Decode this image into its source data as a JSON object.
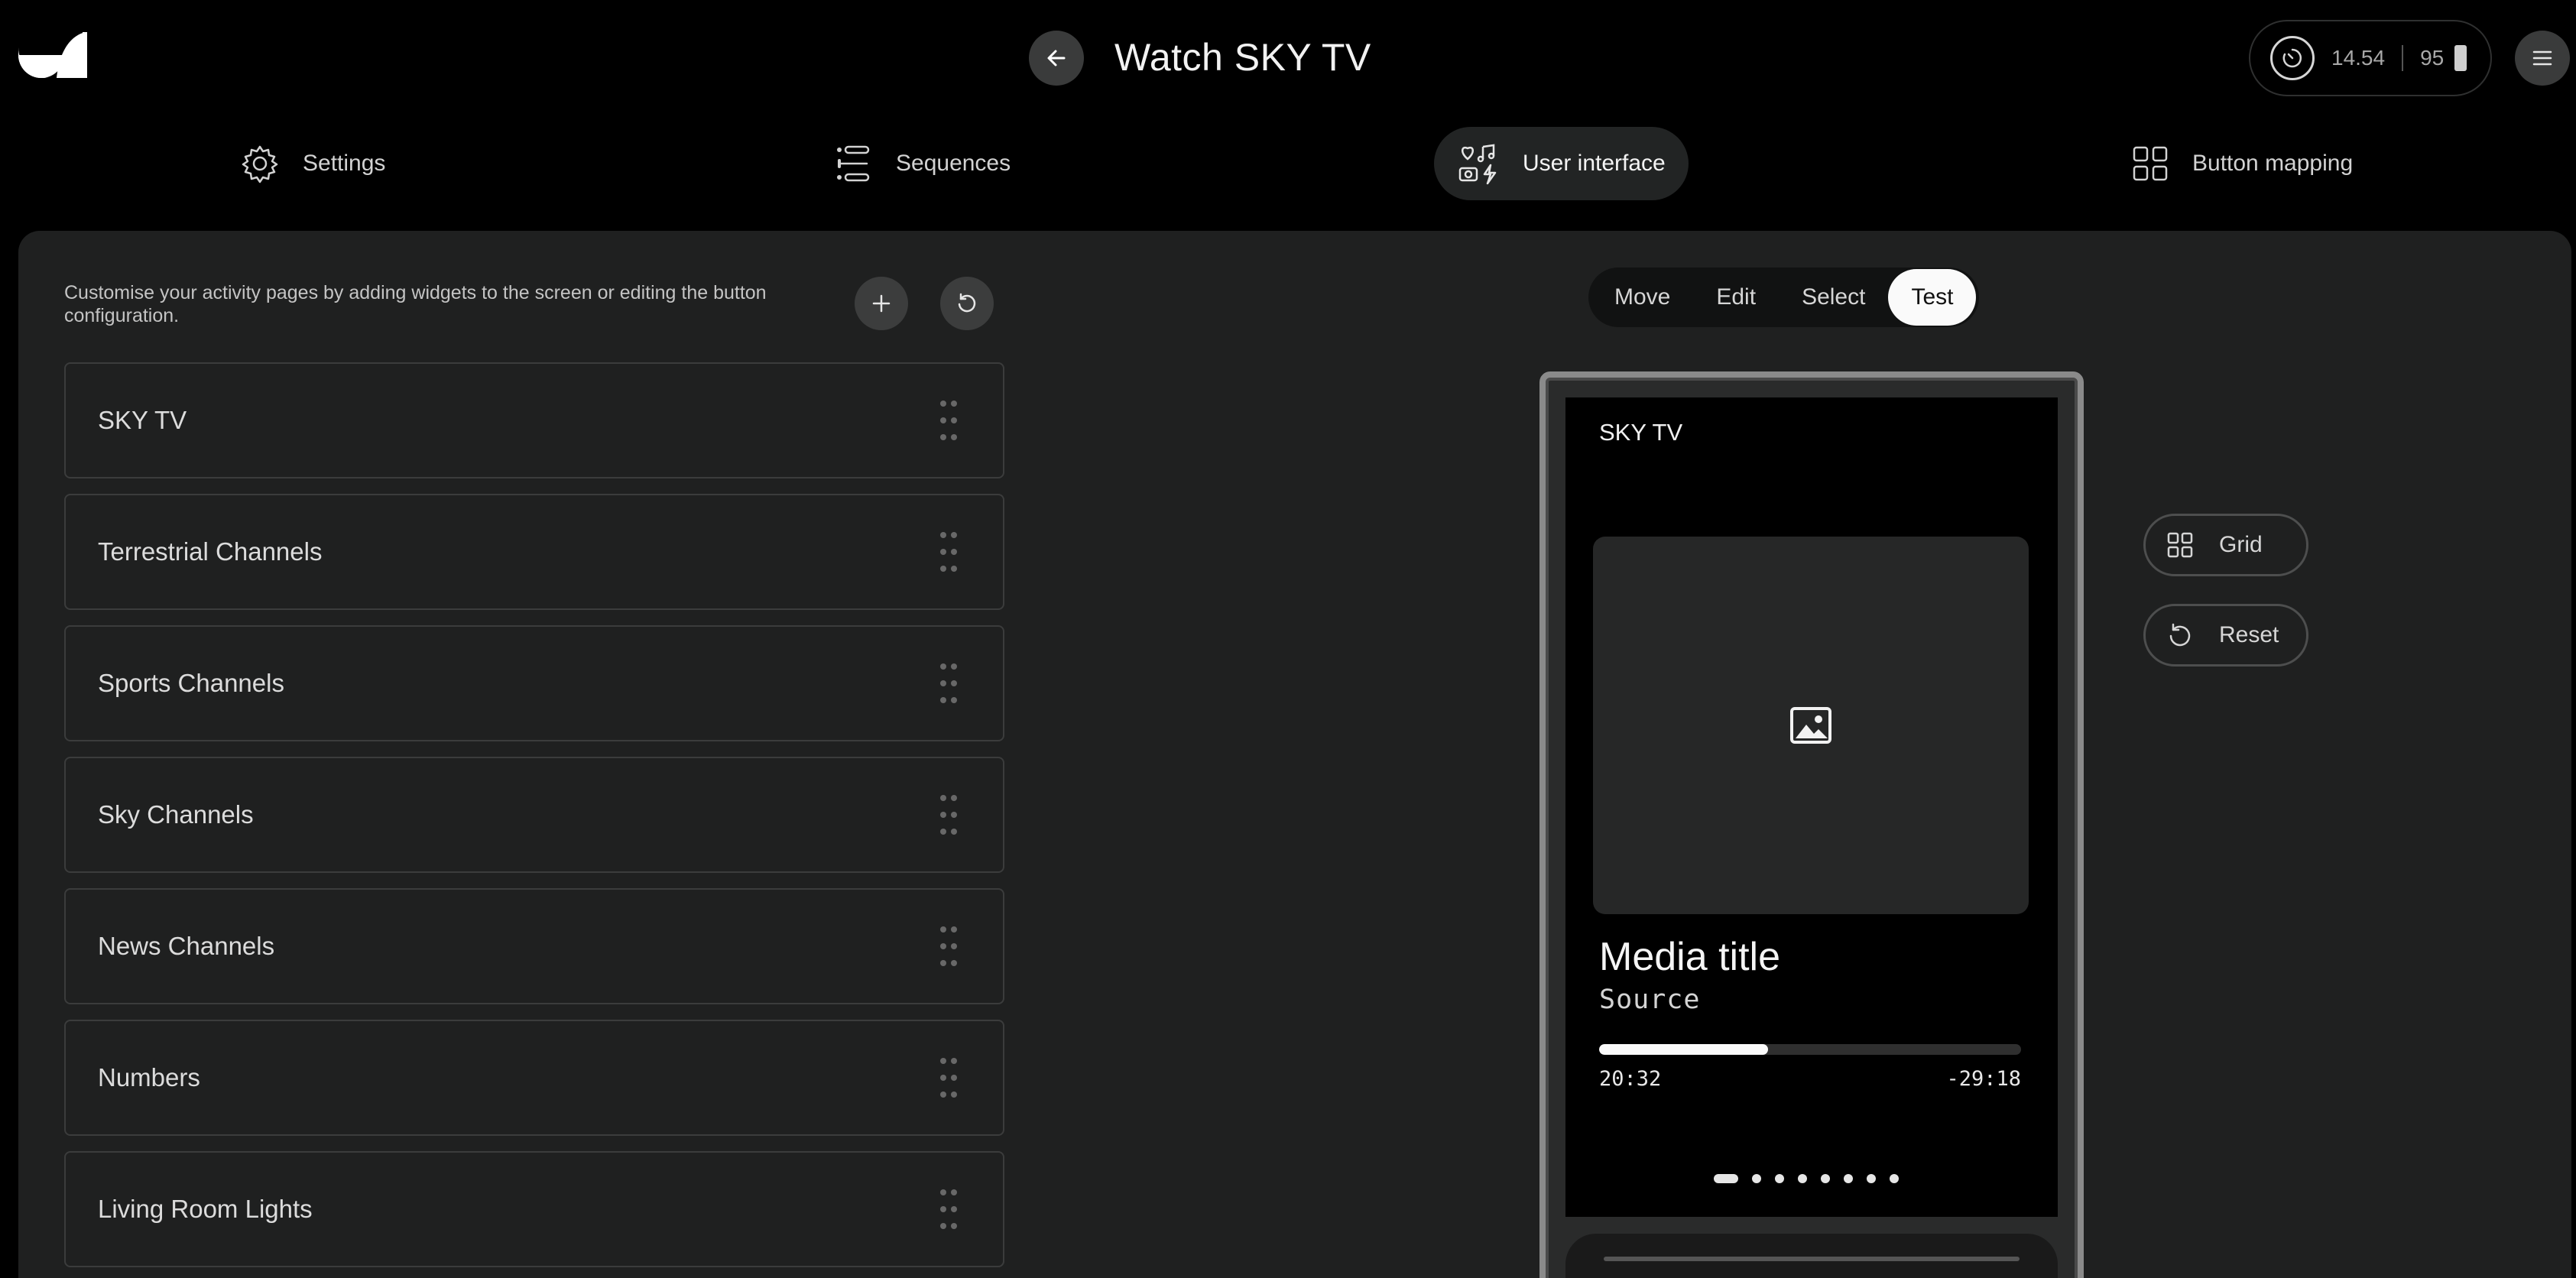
{
  "header": {
    "logo_icon": "brand-logo-icon",
    "back_icon": "arrow-left-icon",
    "title": "Watch SKY TV",
    "status": {
      "time": "14.54",
      "battery": "95",
      "timer_icon": "timer-icon",
      "battery_icon": "battery-icon"
    },
    "menu_icon": "hamburger-menu-icon"
  },
  "nav": {
    "tabs": [
      {
        "label": "Settings",
        "icon": "gear-icon",
        "active": false
      },
      {
        "label": "Sequences",
        "icon": "list-icon",
        "active": false
      },
      {
        "label": "User interface",
        "icon": "widgets-icon",
        "active": true
      },
      {
        "label": "Button mapping",
        "icon": "grid-icon",
        "active": false
      }
    ]
  },
  "panel": {
    "description": "Customise your activity pages by adding widgets to the screen or editing the button configuration.",
    "add_icon": "plus-icon",
    "reset_icon": "refresh-icon",
    "pages": [
      "SKY TV",
      "Terrestrial Channels",
      "Sports Channels",
      "Sky Channels",
      "News Channels",
      "Numbers",
      "Living Room Lights"
    ]
  },
  "modes": {
    "items": [
      "Move",
      "Edit",
      "Select",
      "Test"
    ],
    "selected": "Test"
  },
  "preview": {
    "screen_title": "SKY TV",
    "media_title": "Media title",
    "source": "Source",
    "elapsed": "20:32",
    "remaining": "-29:18",
    "progress": 0.4,
    "image_icon": "image-icon",
    "page_dots": 8,
    "active_dot": 0
  },
  "side_buttons": {
    "grid_label": "Grid",
    "reset_label": "Reset"
  }
}
